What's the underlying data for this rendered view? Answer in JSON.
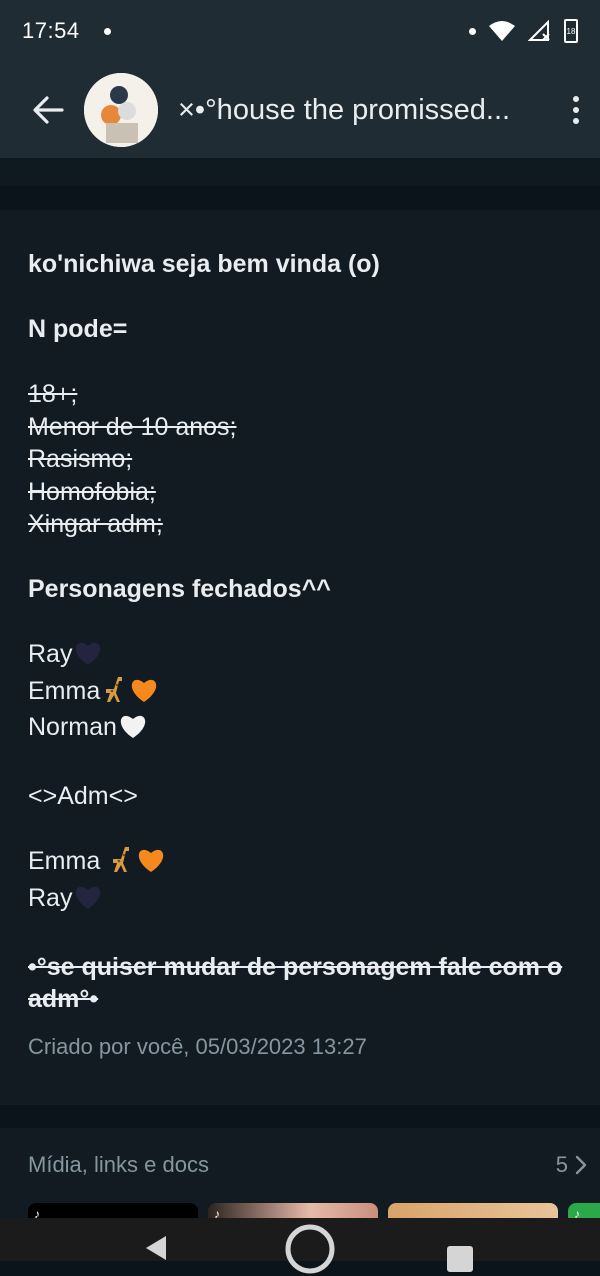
{
  "status": {
    "time": "17:54",
    "battery": "18"
  },
  "header": {
    "title": "×•°house the promissed..."
  },
  "description": {
    "lines": [
      {
        "text": "ko'nichiwa seja bem vinda (o)",
        "style": "bold"
      },
      {
        "text": "",
        "style": "blank"
      },
      {
        "text": "N pode=",
        "style": "bold"
      },
      {
        "text": "",
        "style": "blank"
      },
      {
        "text": "18+;",
        "style": "strike"
      },
      {
        "text": "Menor de 10 anos;",
        "style": "strike"
      },
      {
        "text": "Rasismo;",
        "style": "strike"
      },
      {
        "text": "Homofobia;",
        "style": "strike"
      },
      {
        "text": "Xingar adm;",
        "style": "strike"
      },
      {
        "text": "",
        "style": "blank"
      },
      {
        "text": "Personagens fechados^^",
        "style": "bold"
      },
      {
        "text": "",
        "style": "blank"
      },
      {
        "text": "Ray",
        "style": "normal",
        "emoji": [
          "heart-dark"
        ]
      },
      {
        "text": "Emma",
        "style": "normal",
        "emoji": [
          "giraffe",
          "heart-orange"
        ]
      },
      {
        "text": "Norman",
        "style": "normal",
        "emoji": [
          "heart-white"
        ]
      },
      {
        "text": "",
        "style": "blank"
      },
      {
        "text": "<>Adm<>",
        "style": "normal"
      },
      {
        "text": "",
        "style": "blank"
      },
      {
        "text": "Emma ",
        "style": "normal",
        "emoji": [
          "giraffe",
          "heart-orange"
        ]
      },
      {
        "text": "Ray",
        "style": "normal",
        "emoji": [
          "heart-dark"
        ]
      },
      {
        "text": "",
        "style": "blank"
      },
      {
        "text": "•°se quiser mudar de personagem fale com o adm°•",
        "style": "bold-strike"
      }
    ],
    "created_by": "Criado por você, 05/03/2023 13:27"
  },
  "media": {
    "title": "Mídia, links e docs",
    "count": "5"
  },
  "colors": {
    "bar_bg": "#1f2c34",
    "card_bg": "#111b21",
    "page_bg": "#0b141a",
    "muted_text": "#8696a0"
  }
}
